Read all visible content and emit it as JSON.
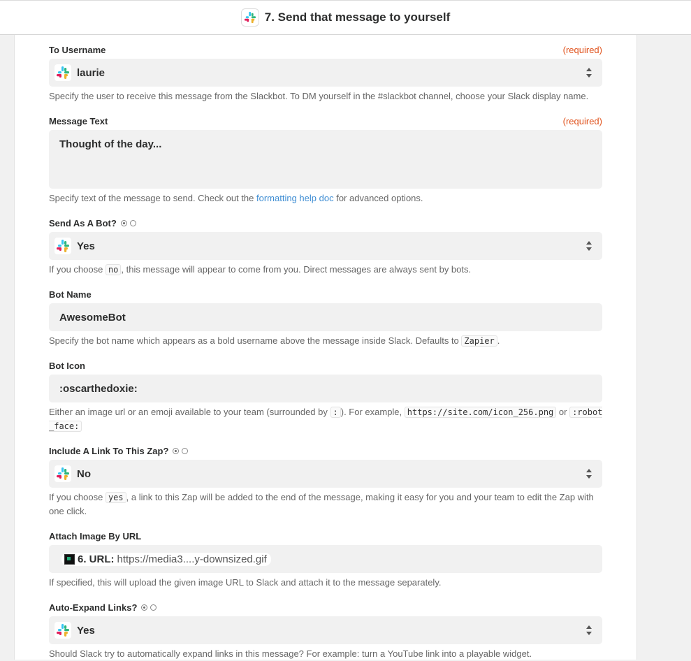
{
  "header": {
    "title": "7. Send that message to yourself"
  },
  "colors": {
    "required": "#e0521c",
    "link": "#3e8dd3",
    "slack_aubergine": "#4a154b"
  },
  "fields": {
    "to_username": {
      "label": "To Username",
      "required": "(required)",
      "value": "laurie",
      "help": "Specify the user to receive this message from the Slackbot. To DM yourself in the #slackbot channel, choose your Slack display name."
    },
    "message_text": {
      "label": "Message Text",
      "required": "(required)",
      "value": "Thought of the day...",
      "help_prefix": "Specify text of the message to send. Check out the ",
      "help_link": "formatting help doc",
      "help_suffix": " for advanced options."
    },
    "send_as_bot": {
      "label": "Send As A Bot?",
      "value": "Yes",
      "help_prefix": "If you choose ",
      "help_code": "no",
      "help_suffix": ", this message will appear to come from you. Direct messages are always sent by bots."
    },
    "bot_name": {
      "label": "Bot Name",
      "value": "AwesomeBot",
      "help_prefix": "Specify the bot name which appears as a bold username above the message inside Slack. Defaults to ",
      "help_code": "Zapier",
      "help_suffix": "."
    },
    "bot_icon": {
      "label": "Bot Icon",
      "value": ":oscarthedoxie:",
      "help_prefix": "Either an image url or an emoji available to your team (surrounded by ",
      "help_code1": ":",
      "help_mid1": "). For example, ",
      "help_code2": "https://site.com/icon_256.png",
      "help_mid2": " or ",
      "help_code3": ":robot_face:"
    },
    "include_link": {
      "label": "Include A Link To This Zap?",
      "value": "No",
      "help_prefix": "If you choose ",
      "help_code": "yes",
      "help_suffix": ", a link to this Zap will be added to the end of the message, making it easy for you and your team to edit the Zap with one click."
    },
    "attach_image": {
      "label": "Attach Image By URL",
      "pill_step": "6. URL:",
      "pill_value": "https://media3....y-downsized.gif",
      "help": "If specified, this will upload the given image URL to Slack and attach it to the message separately."
    },
    "auto_expand": {
      "label": "Auto-Expand Links?",
      "value": "Yes",
      "help": "Should Slack try to automatically expand links in this message? For example: turn a YouTube link into a playable widget."
    }
  }
}
